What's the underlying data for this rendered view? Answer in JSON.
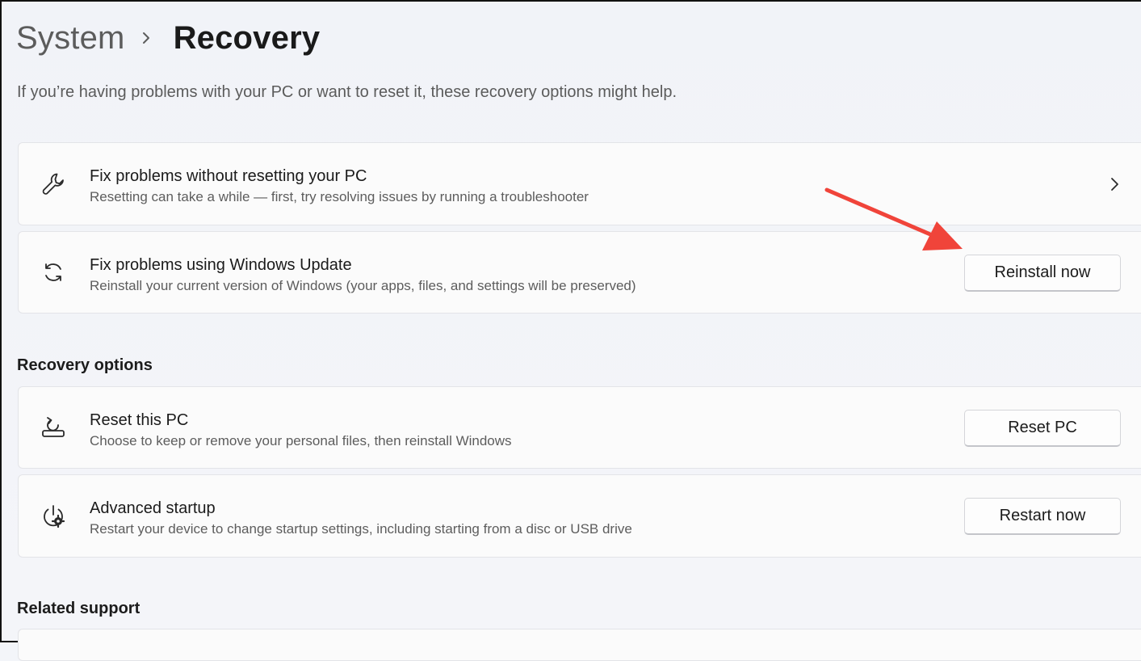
{
  "breadcrumb": {
    "parent": "System",
    "current": "Recovery"
  },
  "intro": "If you’re having problems with your PC or want to reset it, these recovery options might help.",
  "cards_top": [
    {
      "icon": "wrench-icon",
      "title": "Fix problems without resetting your PC",
      "subtitle": "Resetting can take a while — first, try resolving issues by running a troubleshooter"
    },
    {
      "icon": "refresh-icon",
      "title": "Fix problems using Windows Update",
      "subtitle": "Reinstall your current version of Windows (your apps, files, and settings will be preserved)",
      "button": "Reinstall now"
    }
  ],
  "recovery_options": {
    "heading": "Recovery options",
    "items": [
      {
        "icon": "reset-pc-icon",
        "title": "Reset this PC",
        "subtitle": "Choose to keep or remove your personal files, then reinstall Windows",
        "button": "Reset PC"
      },
      {
        "icon": "advanced-startup-icon",
        "title": "Advanced startup",
        "subtitle": "Restart your device to change startup settings, including starting from a disc or USB drive",
        "button": "Restart now"
      }
    ]
  },
  "related_support": {
    "heading": "Related support"
  },
  "colors": {
    "annotation_arrow": "#f0443a",
    "background": "#f3f5f9",
    "card": "#fbfbfb"
  }
}
